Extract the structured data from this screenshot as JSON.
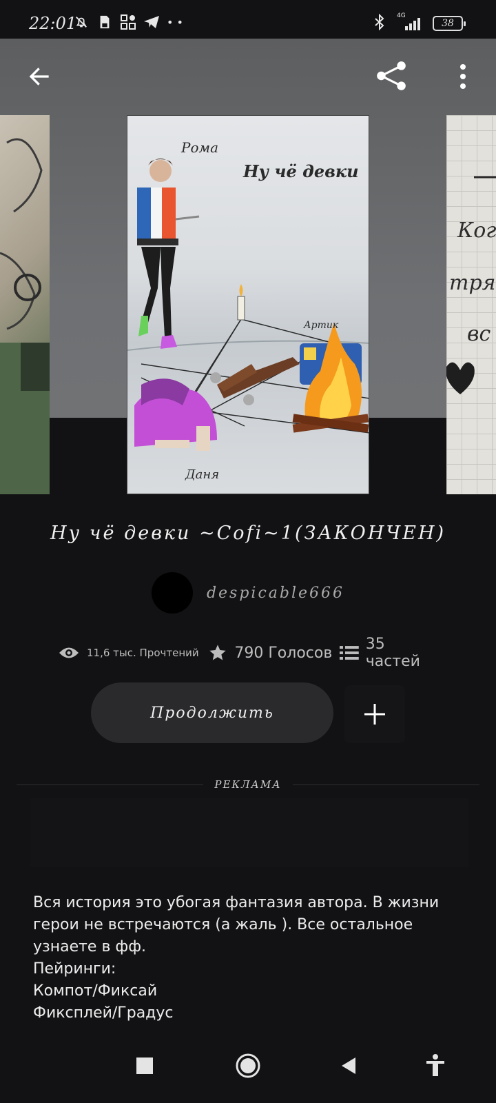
{
  "status_bar": {
    "time": "22:01",
    "battery": "38",
    "network": "4G",
    "icons": [
      "mute-icon",
      "sd-card-icon",
      "app-grid-icon",
      "telegram-icon",
      "more-dots-icon",
      "bluetooth-icon",
      "signal-icon",
      "battery-icon"
    ]
  },
  "toolbar": {
    "back_icon": "arrow-left-icon",
    "share_icon": "share-icon",
    "more_icon": "more-vertical-icon"
  },
  "cover": {
    "main_caption": "Ну чё девки",
    "label_roma": "Рома",
    "label_artik": "Артик",
    "label_danya": "Даня",
    "right_cover_text": [
      "Ког",
      "тряно",
      "вс"
    ]
  },
  "story": {
    "title": "Ну чё девки ~Cofi~1(ЗАКОНЧЕН)",
    "author": "despicable666",
    "reads": "11,6 тыс. Прочтений",
    "votes": "790 Голосов",
    "parts": "35 частей",
    "continue_label": "Продолжить",
    "ad_label": "РЕКЛАМА",
    "description": "Вся история это убогая фантазия автора. В жизни герои не встречаются (а жаль ). Все остальное узнаете в фф.\nПейринги:\nКомпот/Фиксай\nФиксплей/Градус\nЖитель/Пиксель"
  },
  "colors": {
    "background": "#121214",
    "button": "#2a2a2c",
    "hero": "#6a6c6e",
    "text_secondary": "#bdbdbd"
  }
}
